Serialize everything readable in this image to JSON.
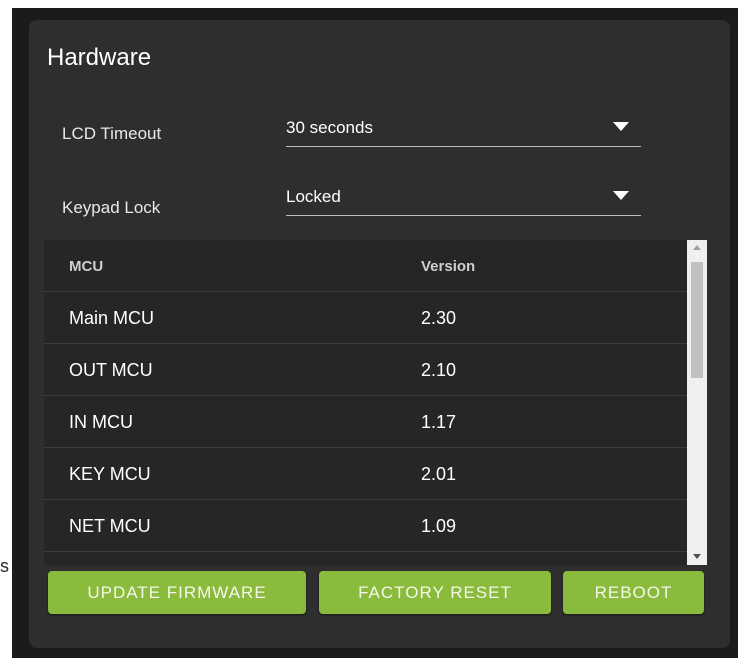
{
  "panel": {
    "title": "Hardware"
  },
  "settings": {
    "lcd_timeout": {
      "label": "LCD Timeout",
      "value": "30 seconds"
    },
    "keypad_lock": {
      "label": "Keypad Lock",
      "value": "Locked"
    }
  },
  "table": {
    "headers": {
      "mcu": "MCU",
      "version": "Version"
    },
    "rows": [
      {
        "mcu": "Main MCU",
        "version": "2.30"
      },
      {
        "mcu": "OUT MCU",
        "version": "2.10"
      },
      {
        "mcu": "IN MCU",
        "version": "1.17"
      },
      {
        "mcu": "KEY MCU",
        "version": "2.01"
      },
      {
        "mcu": "NET MCU",
        "version": "1.09"
      }
    ]
  },
  "buttons": {
    "update_firmware": "UPDATE FIRMWARE",
    "factory_reset": "FACTORY RESET",
    "reboot": "REBOOT"
  },
  "edge": {
    "glyph": "s"
  },
  "colors": {
    "background": "#2e2e2e",
    "accent_button": "#8bbb3c",
    "text": "#ffffff"
  }
}
